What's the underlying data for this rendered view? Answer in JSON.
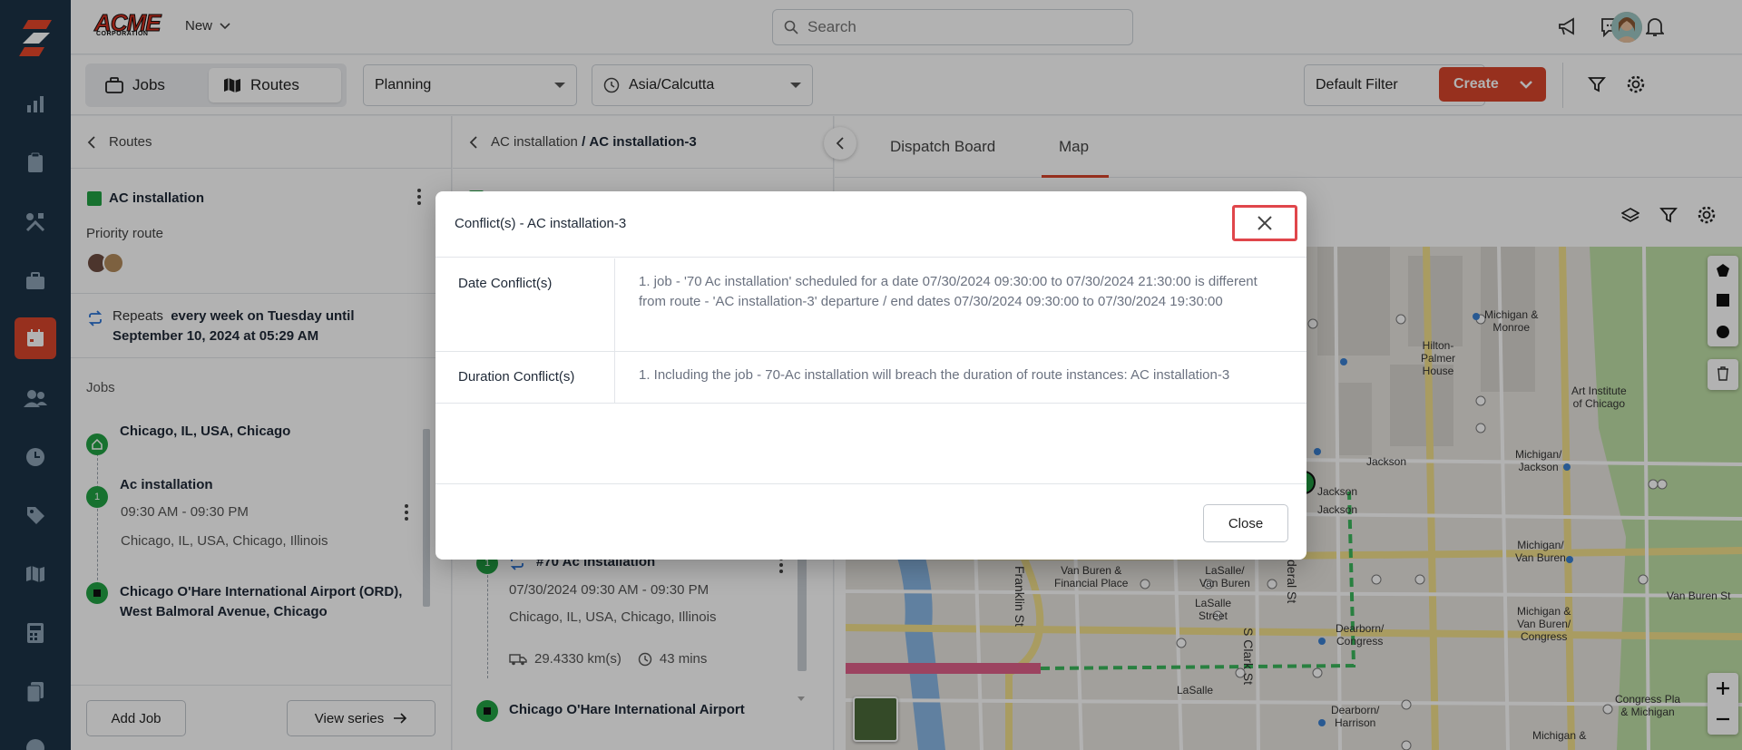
{
  "app": {
    "company": "ACME",
    "company_sub": "CORPORATION",
    "new_label": "New",
    "search_placeholder": "Search"
  },
  "toolbar": {
    "jobs_tab": "Jobs",
    "routes_tab": "Routes",
    "planning": "Planning",
    "timezone": "Asia/Calcutta",
    "default_filter": "Default Filter",
    "create": "Create"
  },
  "left_panel": {
    "back_label": "Routes",
    "route_name": "AC installation",
    "priority": "Priority route",
    "repeats_prefix": "Repeats",
    "repeats_bold_1": "every week on Tuesday until",
    "repeats_bold_2": "September 10, 2024 at 05:29 AM",
    "jobs_label": "Jobs",
    "stops": [
      {
        "title": "Chicago, IL, USA, Chicago"
      },
      {
        "title": "Ac installation",
        "num": "1",
        "time": "09:30 AM - 09:30 PM",
        "address": "Chicago, IL, USA, Chicago, Illinois"
      },
      {
        "title_1": "Chicago O'Hare International Airport (ORD),",
        "title_2": "West Balmoral Avenue, Chicago"
      }
    ],
    "add_job": "Add Job",
    "view_series": "View series"
  },
  "mid_panel": {
    "crumb_parent": "AC installation",
    "crumb_sep": "/",
    "crumb_current": "AC installation-3",
    "job_num": "1",
    "job_title": "#70 Ac installation",
    "job_datetime": "07/30/2024 09:30 AM - 09:30 PM",
    "job_address": "Chicago, IL, USA, Chicago, Illinois",
    "distance": "29.4330 km(s)",
    "duration": "43 mins",
    "end_stop": "Chicago O'Hare International Airport"
  },
  "right_panel": {
    "tabs": [
      "Dispatch Board",
      "Map"
    ],
    "active_tab": "Map"
  },
  "map": {
    "labels": [
      "Michigan & Monroe",
      "Hilton-Palmer House",
      "Art Institute of Chicago",
      "Jackson",
      "Michigan/ Jackson",
      "Jackson",
      "Jackson",
      "Van Buren & Financial Place",
      "LaSalle/ Van Buren",
      "LaSalle Street",
      "Michigan/ Van Buren",
      "Van Buren St",
      "Michigan & Van Buren/ Congress",
      "Dearborn/ Congress",
      "LaSalle",
      "Dearborn/ Harrison",
      "Congress Pla & Michigan",
      "Michigan &",
      "Franklin St",
      "S Clark St",
      "deral St"
    ]
  },
  "modal": {
    "title": "Conflict(s) - AC installation-3",
    "rows": [
      {
        "key": "Date Conflict(s)",
        "value": "1. job - '70 Ac installation' scheduled for a date 07/30/2024 09:30:00 to 07/30/2024 21:30:00 is different from route - 'AC installation-3' departure / end dates 07/30/2024 09:30:00 to 07/30/2024 19:30:00"
      },
      {
        "key": "Duration Conflict(s)",
        "value": "1. Including the job - 70-Ac installation will breach the duration of route instances: AC installation-3"
      }
    ],
    "close": "Close"
  },
  "colors": {
    "rail": "#1c3347",
    "accent": "#d9452b",
    "route_green": "#22a244",
    "highlight_red": "#e0464b"
  }
}
